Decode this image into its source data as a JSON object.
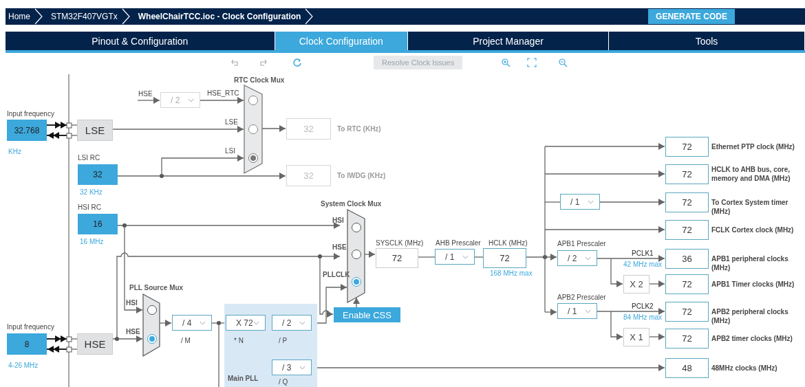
{
  "breadcrumbs": [
    {
      "label": "Home",
      "bold": false
    },
    {
      "label": "STM32F407VGTx",
      "bold": false
    },
    {
      "label": "WheelChairTCC.ioc - Clock Configuration",
      "bold": true
    }
  ],
  "generate_button": "GENERATE CODE",
  "tabs": [
    {
      "label": "Pinout & Configuration",
      "selected": false
    },
    {
      "label": "Clock Configuration",
      "selected": true
    },
    {
      "label": "Project Manager",
      "selected": false
    },
    {
      "label": "Tools",
      "selected": false
    }
  ],
  "toolbar": {
    "resolve_button": {
      "label": "Resolve Clock Issues",
      "disabled": true
    }
  },
  "diagram": {
    "lse": {
      "input_label": "Input frequency",
      "input_value": "32.768",
      "unit": "KHz",
      "name": "LSE"
    },
    "lsi": {
      "title": "LSI RC",
      "value": "32",
      "unit": "32 KHz"
    },
    "hsi": {
      "title": "HSI RC",
      "value": "16",
      "unit": "16 MHz"
    },
    "hse": {
      "input_label": "Input frequency",
      "input_value": "8",
      "unit": "4-26 MHz",
      "name": "HSE"
    },
    "rtc_divider": {
      "in_label": "HSE",
      "value": "/ 2",
      "disabled": true
    },
    "rtc_mux": {
      "title": "RTC Clock Mux",
      "disabled": true,
      "inputs": [
        {
          "label": "HSE_RTC",
          "selected": false
        },
        {
          "label": "LSE",
          "selected": false
        },
        {
          "label": "LSI",
          "selected": true
        }
      ]
    },
    "rtc_out": {
      "value": "32",
      "label": "To RTC (KHz)",
      "disabled": true
    },
    "iwdg_out": {
      "value": "32",
      "label": "To IWDG (KHz)",
      "disabled": true
    },
    "sys_mux": {
      "title": "System Clock Mux",
      "disabled": false,
      "inputs": [
        {
          "label": "HSI",
          "selected": false
        },
        {
          "label": "HSE",
          "selected": false
        },
        {
          "label": "PLLCLK",
          "selected": true
        }
      ]
    },
    "pll_mux": {
      "title": "PLL Source Mux",
      "disabled": false,
      "inputs": [
        {
          "label": "HSI",
          "selected": false
        },
        {
          "label": "HSE",
          "selected": true
        }
      ]
    },
    "pll_m": {
      "value": "/ 4",
      "caption": "/ M"
    },
    "main_pll": {
      "title": "Main PLL",
      "n": {
        "value": "X 72",
        "caption": "* N"
      },
      "p": {
        "value": "/ 2",
        "caption": "/ P"
      },
      "q": {
        "value": "/ 3",
        "caption": "/ Q"
      }
    },
    "css_button": "Enable CSS",
    "sysclk": {
      "label": "SYSCLK (MHz)",
      "value": "72"
    },
    "ahb": {
      "label": "AHB Prescaler",
      "value": "/ 1"
    },
    "hclk": {
      "label": "HCLK (MHz)",
      "value": "72",
      "note": "168 MHz max"
    },
    "cortex_div": {
      "value": "/ 1"
    },
    "apb1": {
      "label": "APB1 Prescaler",
      "value": "/ 2",
      "bus": "PCLK1",
      "note": "42 MHz max",
      "mult": "X 2"
    },
    "apb2": {
      "label": "APB2 Prescaler",
      "value": "/ 1",
      "bus": "PCLK2",
      "note": "84 MHz max",
      "mult": "X 1"
    },
    "outputs": [
      {
        "value": "72",
        "label": "Ethernet PTP clock (MHz)"
      },
      {
        "value": "72",
        "label": "HCLK to AHB bus, core, memory and DMA (MHz)"
      },
      {
        "value": "72",
        "label": "To Cortex System timer (MHz)"
      },
      {
        "value": "72",
        "label": "FCLK Cortex clock (MHz)"
      },
      {
        "value": "36",
        "label": "APB1 peripheral clocks (MHz)"
      },
      {
        "value": "72",
        "label": "APB1 Timer clocks (MHz)"
      },
      {
        "value": "72",
        "label": "APB2 peripheral clocks (MHz)"
      },
      {
        "value": "72",
        "label": "APB2 timer clocks (MHz)"
      },
      {
        "value": "48",
        "label": "48MHz clocks (MHz)"
      }
    ]
  }
}
